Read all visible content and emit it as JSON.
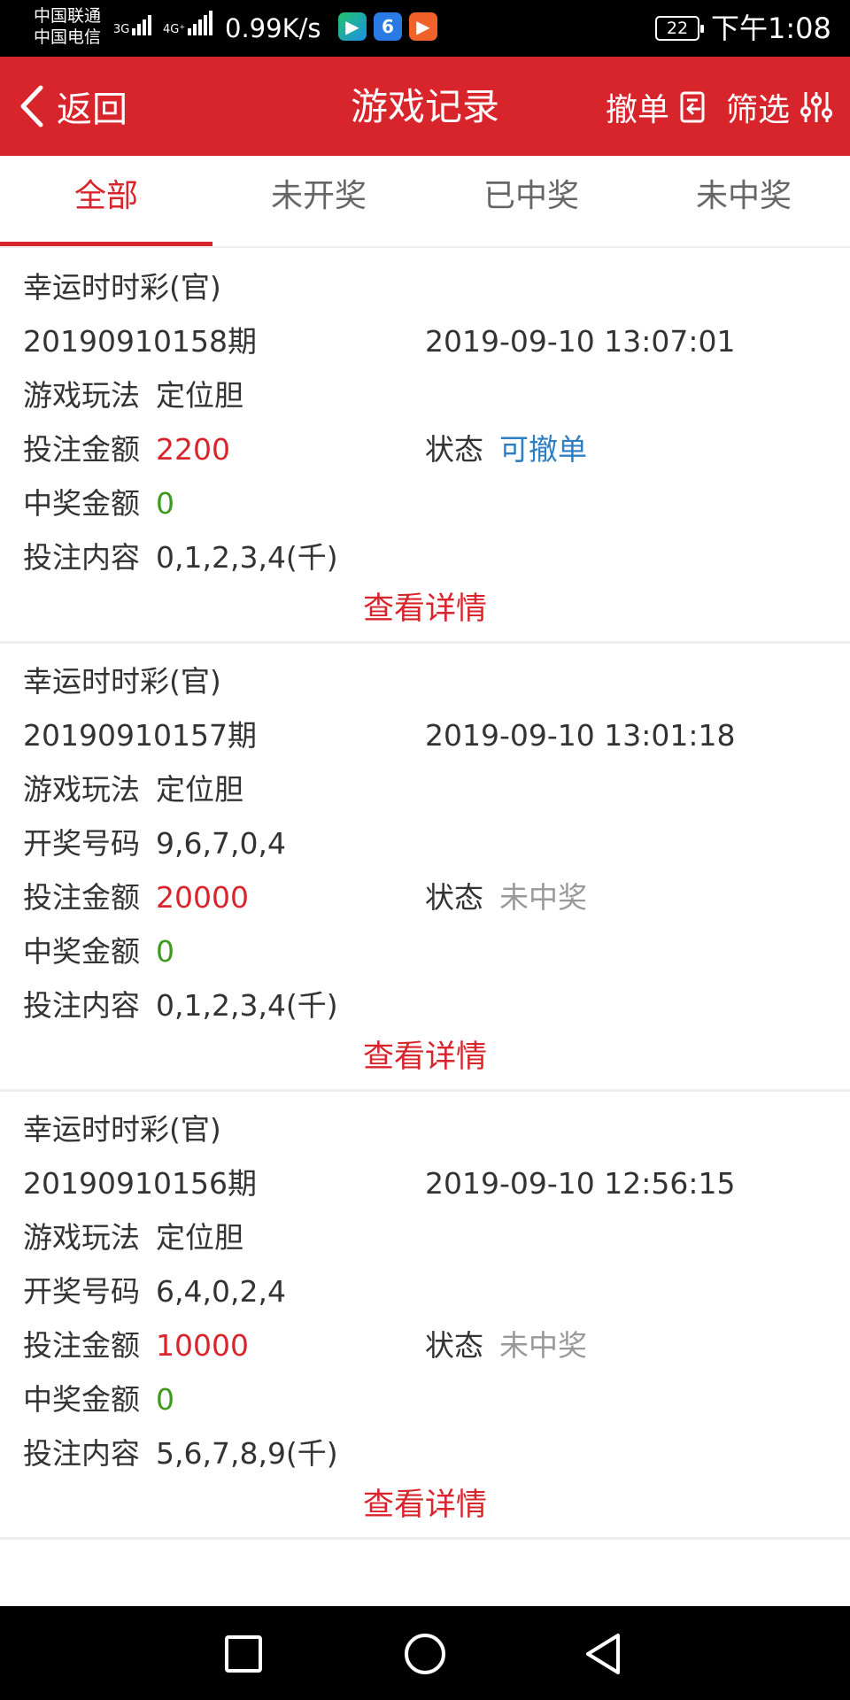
{
  "status_bar": {
    "carrier_1": "中国联通",
    "carrier_2": "中国电信",
    "signal_1": "3G",
    "signal_2": "4G⁺",
    "net_speed": "0.99K/s",
    "battery": "22",
    "time": "下午1:08"
  },
  "nav": {
    "back_label": "返回",
    "title": "游戏记录",
    "cancel_label": "撤单",
    "filter_label": "筛选"
  },
  "tabs": [
    {
      "label": "全部",
      "active": true
    },
    {
      "label": "未开奖",
      "active": false
    },
    {
      "label": "已中奖",
      "active": false
    },
    {
      "label": "未中奖",
      "active": false
    }
  ],
  "labels": {
    "play_method": "游戏玩法",
    "draw_number": "开奖号码",
    "bet_amount": "投注金额",
    "status": "状态",
    "win_amount": "中奖金额",
    "bet_content": "投注内容",
    "view_details": "查看详情"
  },
  "records": [
    {
      "game": "幸运时时彩(官)",
      "period": "20190910158期",
      "datetime": "2019-09-10 13:07:01",
      "play_method": "定位胆",
      "bet_amount": "2200",
      "status": "可撤单",
      "win_amount": "0",
      "bet_content": "0,1,2,3,4(千)"
    },
    {
      "game": "幸运时时彩(官)",
      "period": "20190910157期",
      "datetime": "2019-09-10 13:01:18",
      "play_method": "定位胆",
      "draw_number": "9,6,7,0,4",
      "bet_amount": "20000",
      "status": "未中奖",
      "win_amount": "0",
      "bet_content": "0,1,2,3,4(千)"
    },
    {
      "game": "幸运时时彩(官)",
      "period": "20190910156期",
      "datetime": "2019-09-10 12:56:15",
      "play_method": "定位胆",
      "draw_number": "6,4,0,2,4",
      "bet_amount": "10000",
      "status": "未中奖",
      "win_amount": "0",
      "bet_content": "5,6,7,8,9(千)"
    }
  ],
  "colors": {
    "brand_red": "#d8252c",
    "win_green": "#3c9b1e",
    "cancelable_blue": "#2f7dc3",
    "status_gray": "#999999"
  }
}
